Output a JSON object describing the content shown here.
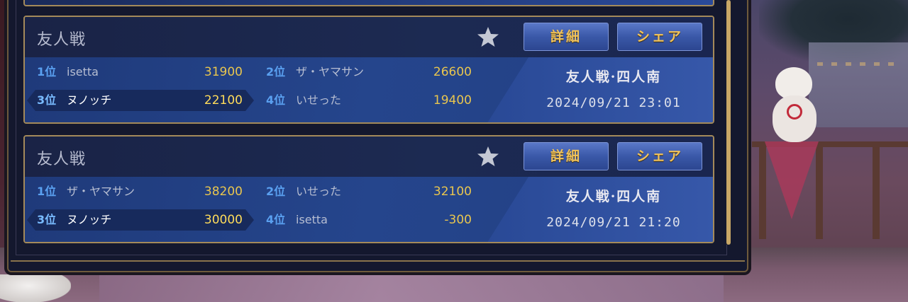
{
  "records": [
    {
      "title": "友人戦",
      "buttons": {
        "detail": "詳細",
        "share": "シェア"
      },
      "players": [
        {
          "rank": "1位",
          "name": "isetta",
          "score": "31900"
        },
        {
          "rank": "2位",
          "name": "ザ・ヤマサン",
          "score": "26600"
        },
        {
          "rank": "3位",
          "name": "ヌノッチ",
          "score": "22100"
        },
        {
          "rank": "4位",
          "name": "いせった",
          "score": "19400"
        }
      ],
      "mode": "友人戦·四人南",
      "datetime": "2024/09/21 23:01"
    },
    {
      "title": "友人戦",
      "buttons": {
        "detail": "詳細",
        "share": "シェア"
      },
      "players": [
        {
          "rank": "1位",
          "name": "ザ・ヤマサン",
          "score": "38200"
        },
        {
          "rank": "2位",
          "name": "いせった",
          "score": "32100"
        },
        {
          "rank": "3位",
          "name": "ヌノッチ",
          "score": "30000"
        },
        {
          "rank": "4位",
          "name": "isetta",
          "score": "-300"
        }
      ],
      "mode": "友人戦·四人南",
      "datetime": "2024/09/21 21:20"
    }
  ],
  "colors": {
    "accent_gold": "#f1c35b",
    "rank_blue": "#5aa0f0",
    "score_yellow": "#e9c64e",
    "card_border": "#a48a5a"
  },
  "icons": {
    "favorite": "star-icon"
  }
}
